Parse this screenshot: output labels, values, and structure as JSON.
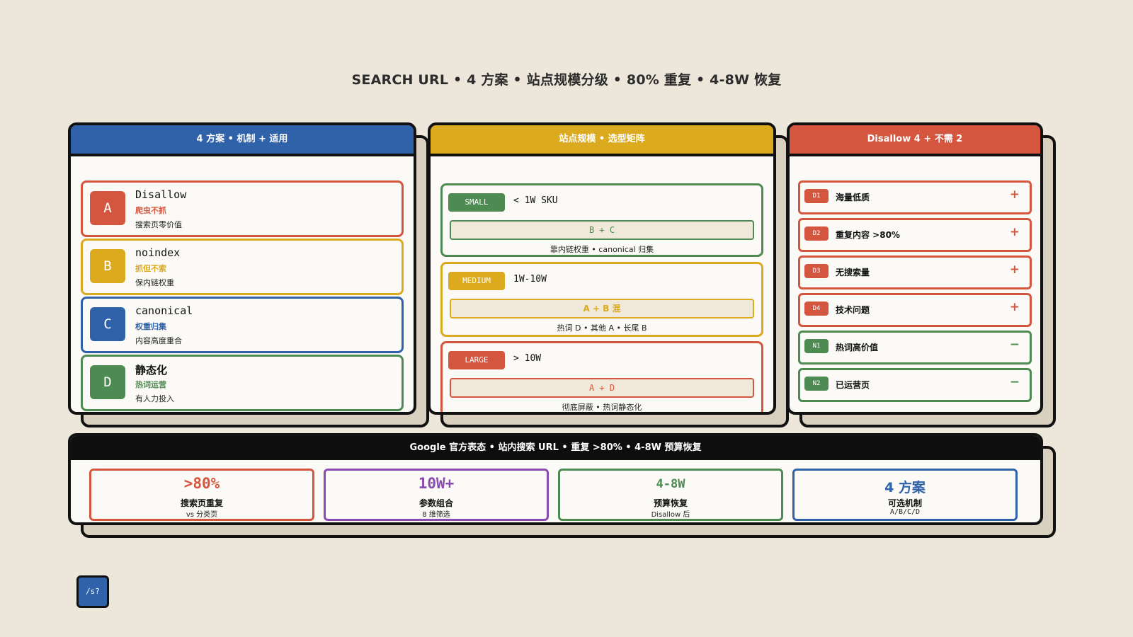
{
  "title": "SEARCH URL • 4 方案 • 站点规模分级 • 80% 重复 • 4-8W 恢复",
  "colors": {
    "blue": "#2f62a8",
    "yellow": "#dcaa1f",
    "red": "#d5563f",
    "green": "#4d8b52",
    "purple": "#8a4bb0",
    "black": "#0e0e0e",
    "bg": "#ece7da"
  },
  "col1": {
    "header": "4 方案 • 机制 + 适用",
    "options": [
      {
        "badge": "A",
        "name": "Disallow",
        "mechanism": "爬虫不抓",
        "fit": "搜索页零价值"
      },
      {
        "badge": "B",
        "name": "noindex",
        "mechanism": "抓但不索",
        "fit": "保内链权重"
      },
      {
        "badge": "C",
        "name": "canonical",
        "mechanism": "权重归集",
        "fit": "内容高度重合"
      },
      {
        "badge": "D",
        "name": "静态化",
        "mechanism": "热词运营",
        "fit": "有人力投入"
      }
    ]
  },
  "col2": {
    "header": "站点规模 • 选型矩阵",
    "sizes": [
      {
        "tag": "SMALL",
        "range": "< 1W SKU",
        "combo": "B + C",
        "note": "靠内链权重 • canonical 归集"
      },
      {
        "tag": "MEDIUM",
        "range": "1W-10W",
        "combo": "A + B 混",
        "note": "热词 D • 其他 A • 长尾 B"
      },
      {
        "tag": "LARGE",
        "range": "> 10W",
        "combo": "A + D",
        "note": "彻底屏蔽 • 热词静态化"
      }
    ]
  },
  "col3": {
    "header": "Disallow 4 + 不需 2",
    "rows": [
      {
        "tag": "D1",
        "label": "海量低质",
        "sign": "+"
      },
      {
        "tag": "D2",
        "label": "重复内容 >80%",
        "sign": "+"
      },
      {
        "tag": "D3",
        "label": "无搜索量",
        "sign": "+"
      },
      {
        "tag": "D4",
        "label": "技术问题",
        "sign": "+"
      },
      {
        "tag": "N1",
        "label": "热词高价值",
        "sign": "−"
      },
      {
        "tag": "N2",
        "label": "已运营页",
        "sign": "−"
      }
    ]
  },
  "bottom": {
    "header": "Google 官方表态 • 站内搜索 URL • 重复 >80% • 4-8W 预算恢复",
    "stats": [
      {
        "big": ">80%",
        "label": "搜索页重复",
        "small": "vs 分类页"
      },
      {
        "big": "10W+",
        "label": "参数组合",
        "small": "8 维筛选"
      },
      {
        "big": "4-8W",
        "label": "预算恢复",
        "small": "Disallow 后"
      },
      {
        "big": "4 方案",
        "label": "可选机制",
        "small": "A/B/C/D"
      }
    ]
  },
  "corner_label": "/s?"
}
